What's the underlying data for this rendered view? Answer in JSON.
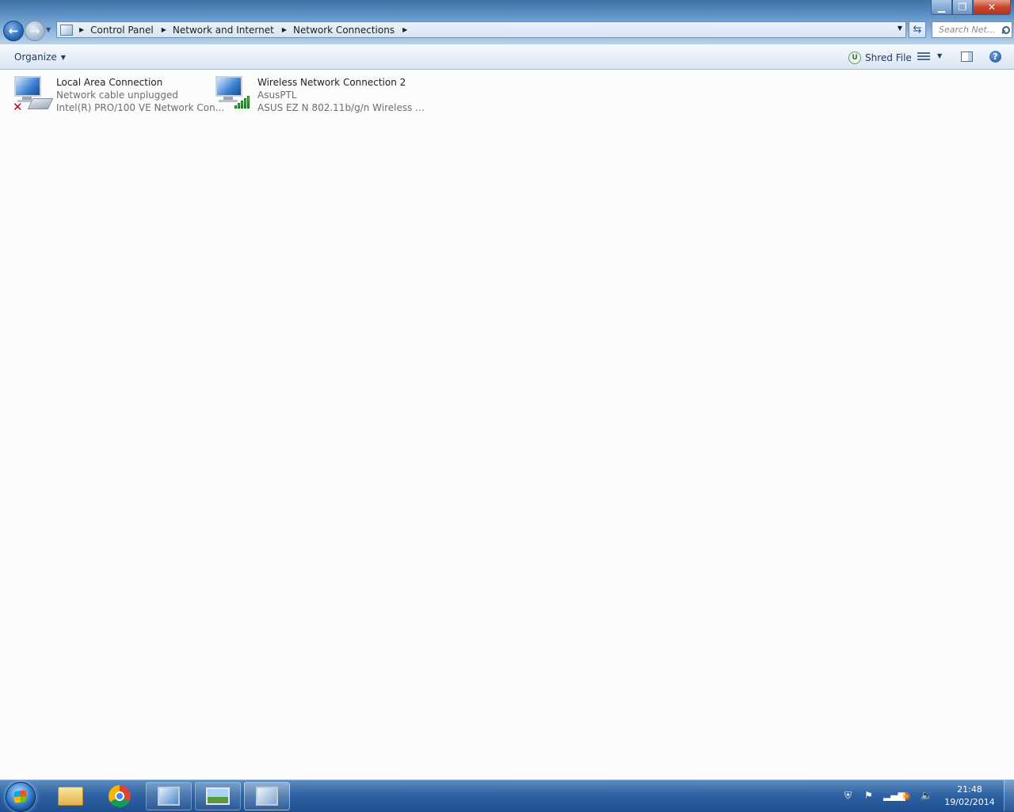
{
  "window": {
    "minimize_glyph": "▁",
    "maximize_glyph": "❐",
    "close_glyph": "✕"
  },
  "address_bar": {
    "breadcrumbs": [
      "Control Panel",
      "Network and Internet",
      "Network Connections"
    ],
    "search_placeholder": "Search Net..."
  },
  "command_bar": {
    "organize_label": "Organize",
    "shred_label": "Shred File",
    "shred_icon_letter": "U",
    "help_glyph": "?"
  },
  "connections": [
    {
      "name": "Local Area Connection",
      "status": "Network cable unplugged",
      "device": "Intel(R) PRO/100 VE Network Con...",
      "icon": "wired-network-disconnected-icon"
    },
    {
      "name": "Wireless Network Connection 2",
      "status": "AsusPTL",
      "device": "ASUS EZ N 802.11b/g/n Wireless ...",
      "icon": "wireless-network-icon",
      "signal_bars": 5
    }
  ],
  "taskbar": {
    "pinned": [
      "windows-explorer-icon",
      "chrome-icon",
      "remote-desktop-icon",
      "photo-viewer-icon",
      "control-panel-icon"
    ],
    "clock_time": "21:48",
    "clock_date": "19/02/2014"
  },
  "colors": {
    "accent": "#3f6fa3",
    "link_text": "#1e395b",
    "secondary_text": "#6d6d6d",
    "disconnected_x": "#d40000"
  }
}
